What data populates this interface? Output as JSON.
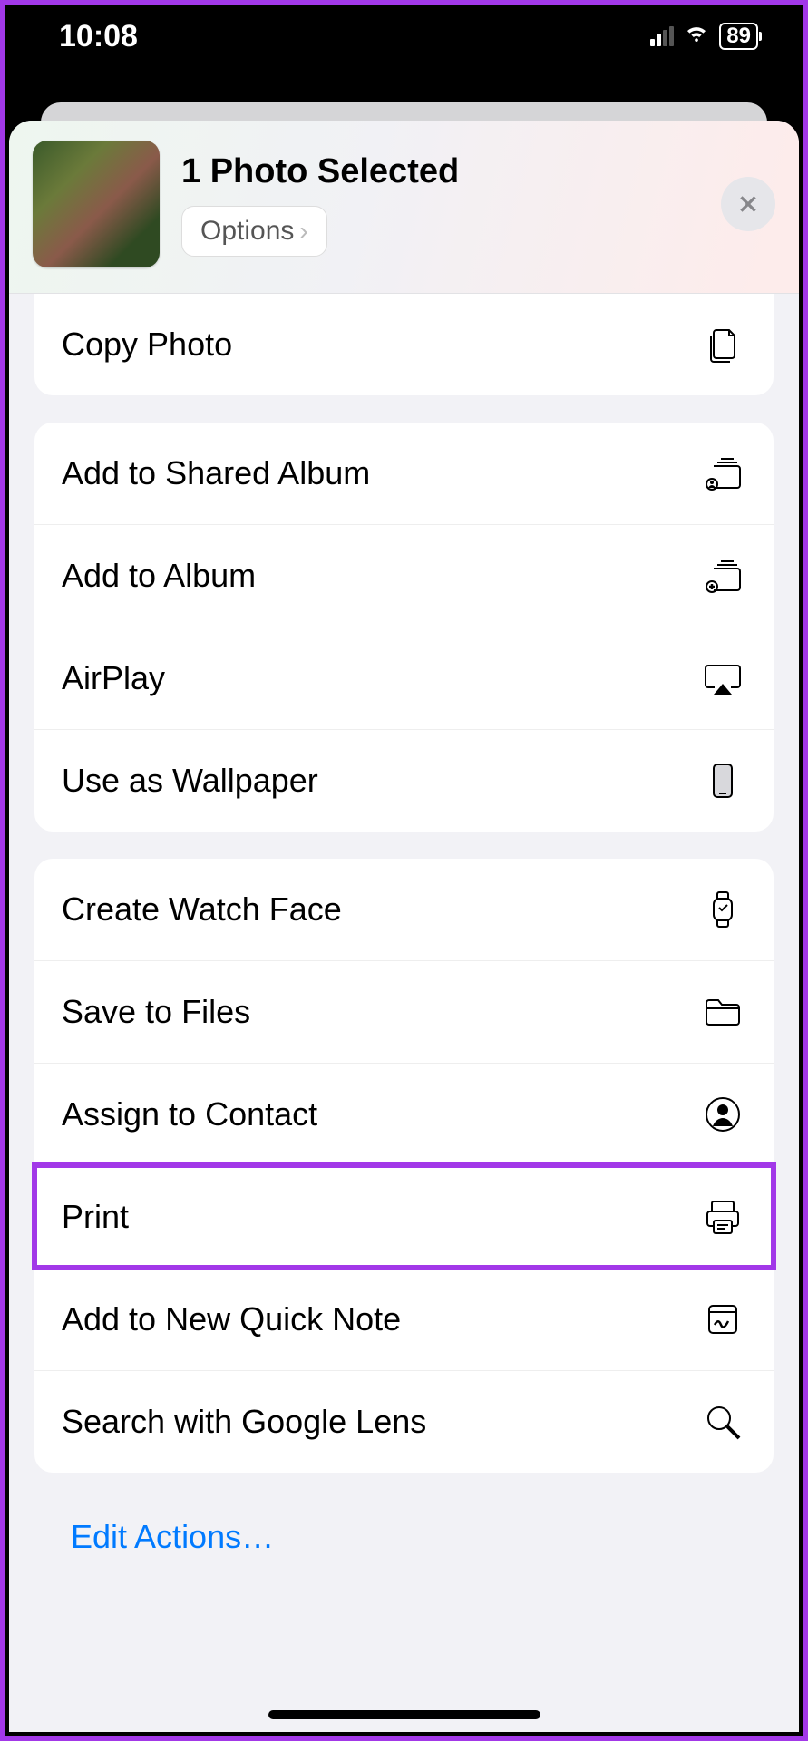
{
  "status": {
    "time": "10:08",
    "battery": "89"
  },
  "header": {
    "title": "1 Photo Selected",
    "options": "Options"
  },
  "groups": [
    {
      "rows": [
        {
          "label": "Copy Photo",
          "icon": "copy-doc-icon"
        }
      ]
    },
    {
      "rows": [
        {
          "label": "Add to Shared Album",
          "icon": "shared-album-icon"
        },
        {
          "label": "Add to Album",
          "icon": "add-album-icon"
        },
        {
          "label": "AirPlay",
          "icon": "airplay-icon"
        },
        {
          "label": "Use as Wallpaper",
          "icon": "phone-icon"
        }
      ]
    },
    {
      "rows": [
        {
          "label": "Create Watch Face",
          "icon": "watch-icon"
        },
        {
          "label": "Save to Files",
          "icon": "folder-icon"
        },
        {
          "label": "Assign to Contact",
          "icon": "contact-icon"
        },
        {
          "label": "Print",
          "icon": "printer-icon",
          "highlight": true
        },
        {
          "label": "Add to New Quick Note",
          "icon": "quicknote-icon"
        },
        {
          "label": "Search with Google Lens",
          "icon": "search-icon"
        }
      ]
    }
  ],
  "editActions": "Edit Actions…"
}
